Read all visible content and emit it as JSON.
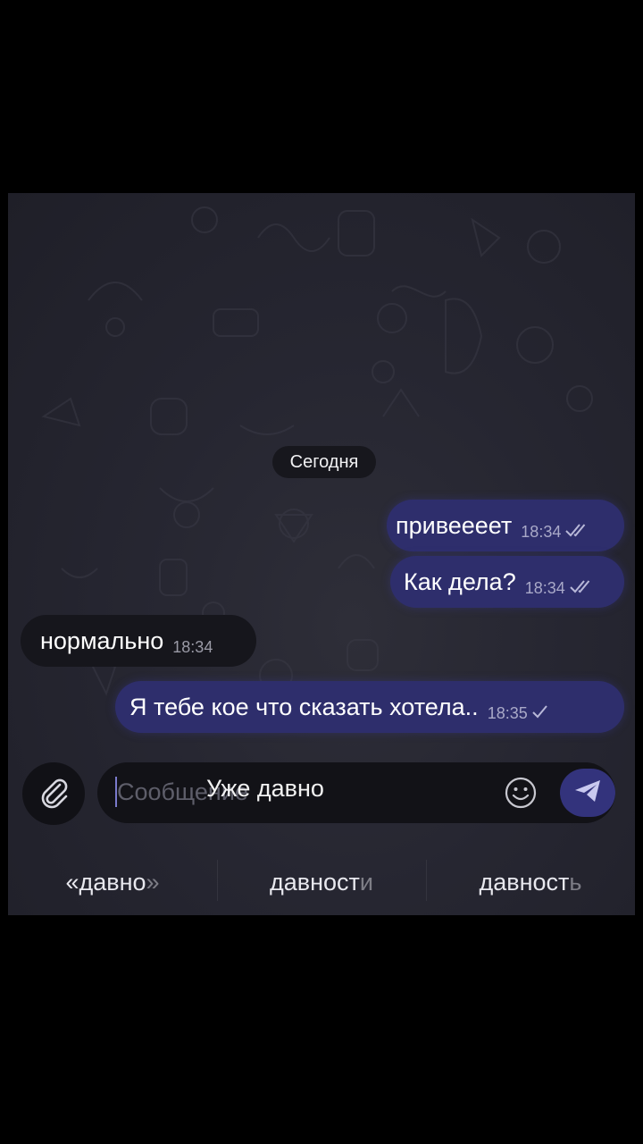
{
  "chat": {
    "date_label": "Сегодня",
    "messages": [
      {
        "text": "привеееет",
        "time": "18:34",
        "direction": "out",
        "status": "read"
      },
      {
        "text": "Как дела?",
        "time": "18:34",
        "direction": "out",
        "status": "read"
      },
      {
        "text": "нормально",
        "time": "18:34",
        "direction": "in"
      },
      {
        "text": "Я тебе кое что сказать хотела..",
        "time": "18:35",
        "direction": "out",
        "status": "sent"
      }
    ]
  },
  "composer": {
    "placeholder": "Сообщение",
    "typed_text": "Уже давно"
  },
  "keyboard": {
    "suggestions": [
      {
        "main": "«давно",
        "tail": "»"
      },
      {
        "main": "давност",
        "tail": "и"
      },
      {
        "main": "давност",
        "tail": "ь"
      }
    ]
  },
  "colors": {
    "outgoing_bubble": "#2e2e6c",
    "incoming_bubble": "#16161c",
    "send_button": "#33337c",
    "background": "#262631"
  },
  "icons": [
    "attach-icon",
    "emoji-icon",
    "send-icon",
    "double-check-icon",
    "check-icon"
  ]
}
